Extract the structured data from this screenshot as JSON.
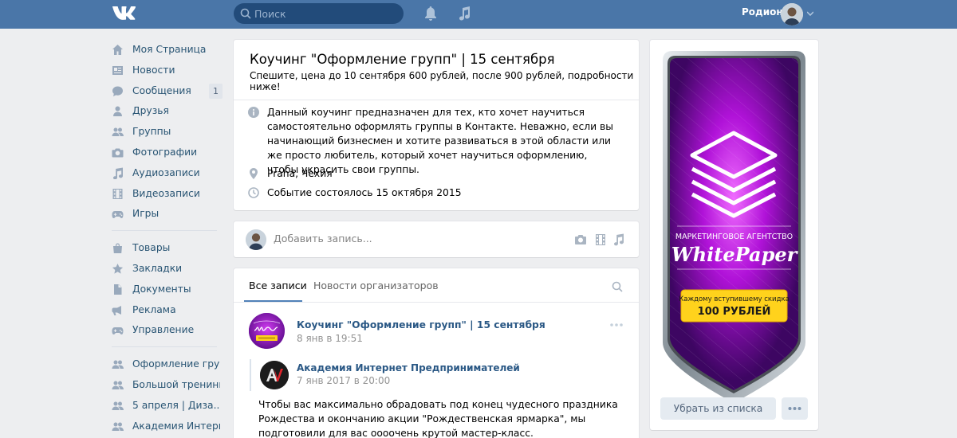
{
  "header": {
    "search_placeholder": "Поиск",
    "user_name": "Родион"
  },
  "leftmenu": {
    "items": [
      {
        "label": "Моя Страница",
        "icon": "home-icon"
      },
      {
        "label": "Новости",
        "icon": "news-icon"
      },
      {
        "label": "Сообщения",
        "icon": "messages-icon",
        "badge": "1"
      },
      {
        "label": "Друзья",
        "icon": "friend-icon"
      },
      {
        "label": "Группы",
        "icon": "groups-icon"
      },
      {
        "label": "Фотографии",
        "icon": "camera-icon"
      },
      {
        "label": "Аудиозаписи",
        "icon": "music-icon"
      },
      {
        "label": "Видеозаписи",
        "icon": "video-icon"
      },
      {
        "label": "Игры",
        "icon": "gamepad-icon"
      }
    ],
    "items2": [
      {
        "label": "Товары",
        "icon": "bag-icon"
      },
      {
        "label": "Закладки",
        "icon": "star-icon"
      },
      {
        "label": "Документы",
        "icon": "document-icon"
      },
      {
        "label": "Реклама",
        "icon": "megaphone-icon"
      },
      {
        "label": "Управление",
        "icon": "gamepad-icon"
      }
    ],
    "items3": [
      {
        "label": "Оформление груп...",
        "icon": "groups-icon"
      },
      {
        "label": "Большой тренинг...",
        "icon": "groups-icon"
      },
      {
        "label": "5 апреля | Диза...",
        "icon": "groups-icon"
      },
      {
        "label": "Академия Интерн...",
        "icon": "groups-icon"
      }
    ]
  },
  "event": {
    "title": "Коучинг \"Оформление групп\" | 15 сентября",
    "subtitle": "Спешите, цена до 10 сентября 600 рублей, после 900 рублей, подробности ниже!",
    "description": "Данный коучинг предназначен для тех, кто хочет научиться самостоятельно оформлять группы в Контакте. Неважно, если вы начинающий бизнесмен и хотите развиваться в этой области или же просто любитель, который хочет научиться оформлению, чтобы украсить свои группы.",
    "location": "Praha, Чехия",
    "status": "Событие состоялось 15 октября 2015"
  },
  "composer": {
    "placeholder": "Добавить запись..."
  },
  "wall": {
    "tab_all": "Все записи",
    "tab_org": "Новости организаторов",
    "post": {
      "author": "Коучинг \"Оформление групп\" | 15 сентября",
      "date": "8 янв в 19:51",
      "repost_author": "Академия Интернет Предпринимателей",
      "repost_date": "7 янв 2017 в 20:00",
      "text": "Чтобы вас максимально обрадовать под конец чудесного праздника Рождества и окончанию акции \"Рождественская ярмарка\", мы подготовили для вас оооочень крутой мастер-класс."
    }
  },
  "banner": {
    "agency": "МАРКЕТИНГОВОЕ АГЕНТСТВО",
    "brand": "WhitePaper",
    "promo_line1": "Каждому вступившему скидка",
    "promo_line2": "100 РУБЛЕЙ"
  },
  "right": {
    "remove_label": "Убрать из списка"
  },
  "colors": {
    "header": "#4a76a8",
    "link": "#2a5885",
    "accent": "#5181b8",
    "banner_purple": "#b012d8"
  }
}
